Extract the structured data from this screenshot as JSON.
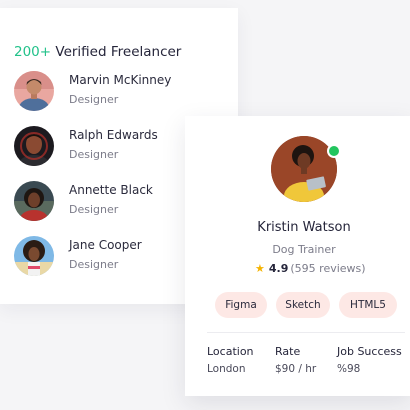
{
  "list": {
    "title_count": "200+",
    "title_text": " Verified Freelancer",
    "items": [
      {
        "name": "Marvin McKinney",
        "role": "Designer"
      },
      {
        "name": "Ralph Edwards",
        "role": "Designer"
      },
      {
        "name": "Annette Black",
        "role": "Designer"
      },
      {
        "name": "Jane Cooper",
        "role": "Designer"
      }
    ]
  },
  "profile": {
    "name": "Kristin Watson",
    "title": "Dog Trainer",
    "rating": "4.9",
    "reviews": "(595 reviews)",
    "tags": [
      "Figma",
      "Sketch",
      "HTML5"
    ],
    "stats": [
      {
        "label": "Location",
        "value": "London"
      },
      {
        "label": "Rate",
        "value": "$90 / hr"
      },
      {
        "label": "Job Success",
        "value": "%98"
      }
    ]
  },
  "colors": {
    "accent_green": "#22c28a",
    "tag_background": "#fde8e5",
    "star": "#f5b301",
    "online": "#22c55e"
  },
  "icons": {
    "rating": "star-icon",
    "status": "online-status-dot"
  }
}
